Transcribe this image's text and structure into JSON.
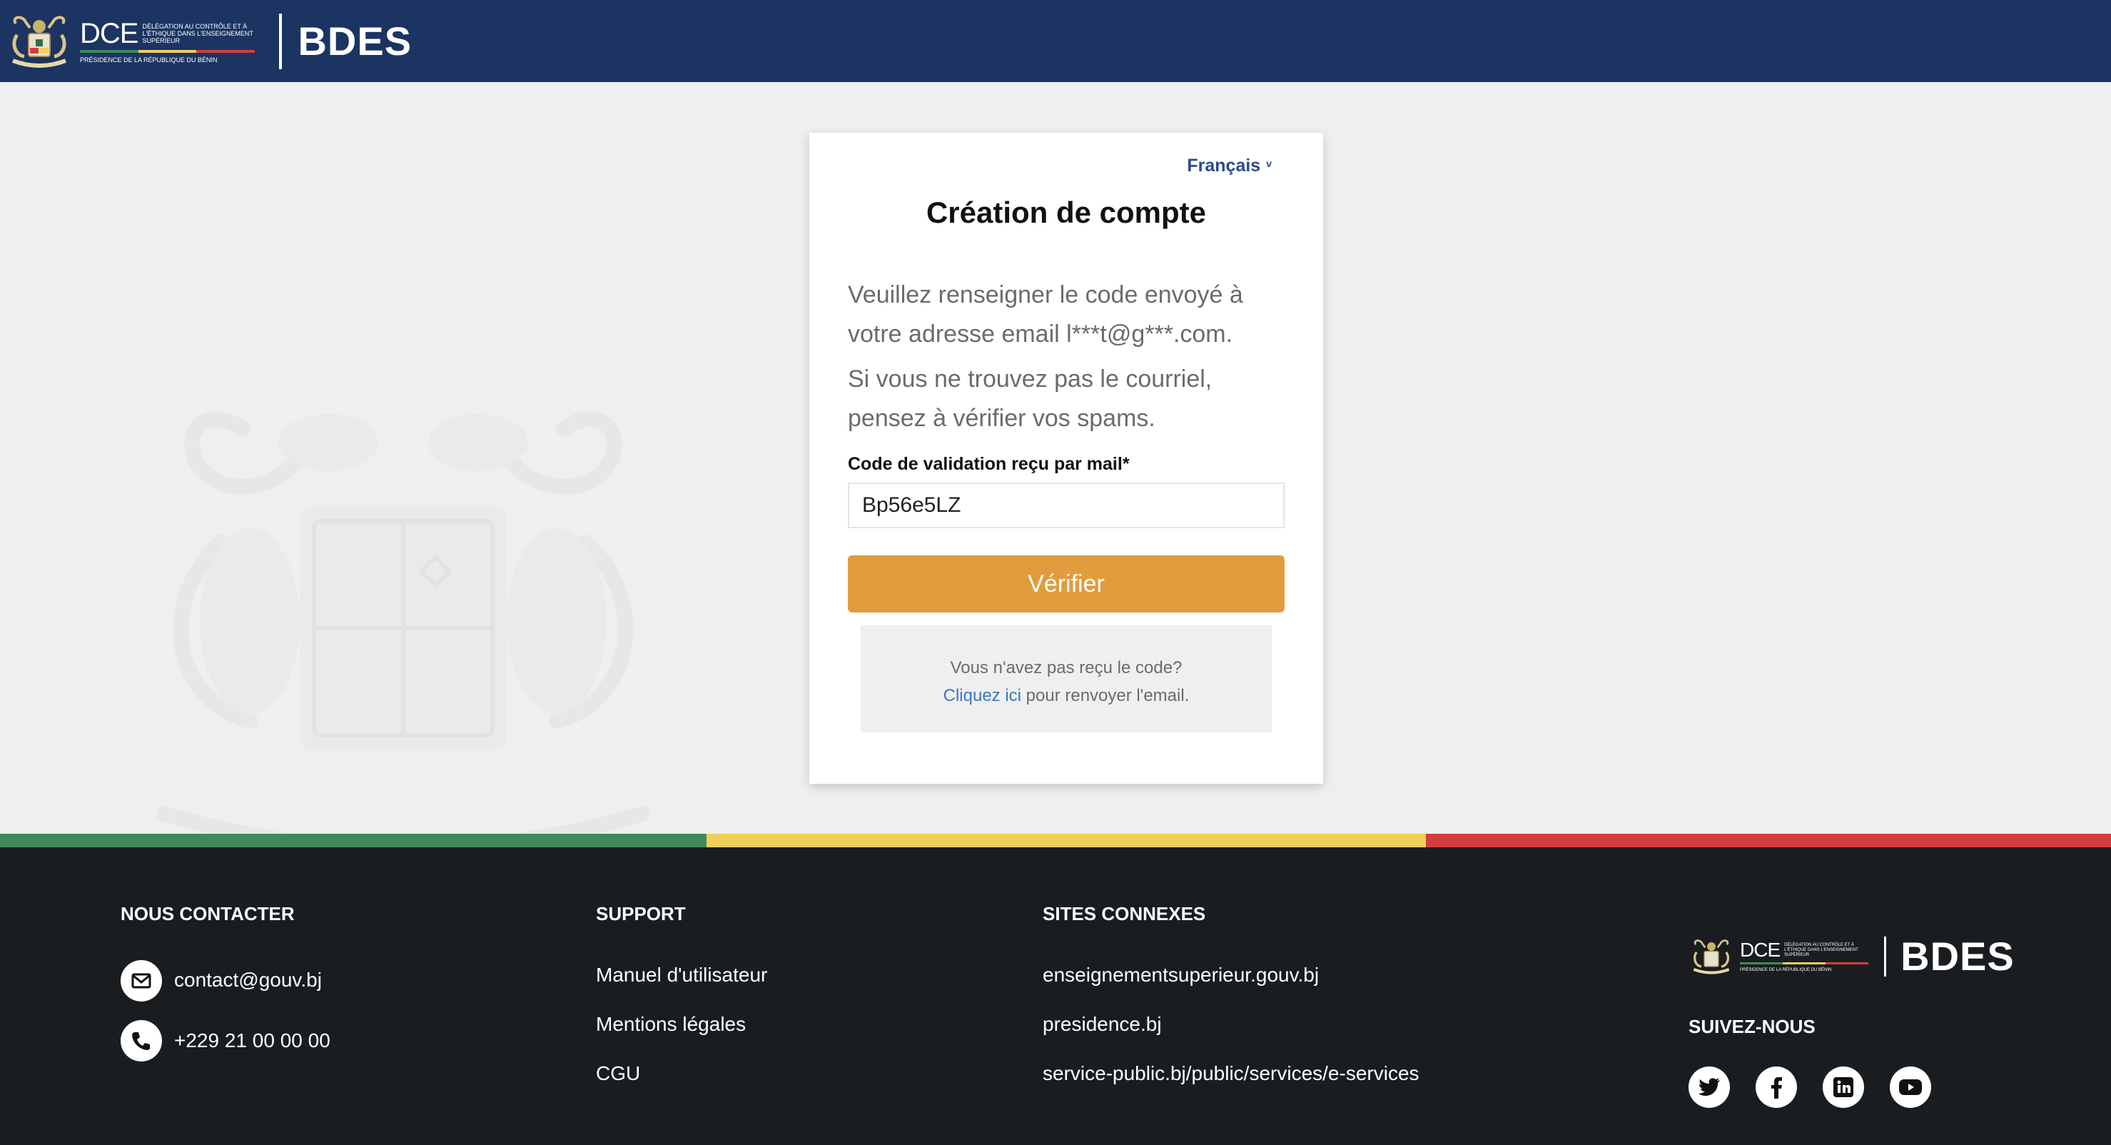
{
  "header": {
    "dce_letters": "DCE",
    "dce_subtitle": "Délégation au contrôle et à l'éthique dans l'enseignement supérieur",
    "presidency": "Présidence de la République du Bénin",
    "app_name": "BDES"
  },
  "card": {
    "language": "Français",
    "title": "Création de compte",
    "instruction_1": "Veuillez renseigner le code envoyé à votre adresse email l***t@g***.com.",
    "instruction_2": "Si vous ne trouvez pas le courriel, pensez à vérifier vos spams.",
    "code_label": "Code de validation reçu par mail*",
    "code_value": "Bp56e5LZ",
    "verify_label": "Vérifier",
    "resend_question": "Vous n'avez pas reçu le code?",
    "resend_link": "Cliquez ici",
    "resend_rest": " pour renvoyer l'email."
  },
  "footer": {
    "contact": {
      "heading": "NOUS CONTACTER",
      "email": "contact@gouv.bj",
      "phone": "+229 21 00 00 00"
    },
    "support": {
      "heading": "SUPPORT",
      "links": [
        "Manuel d'utilisateur",
        "Mentions légales",
        "CGU"
      ]
    },
    "sites": {
      "heading": "SITES CONNEXES",
      "links": [
        "enseignementsuperieur.gouv.bj",
        "presidence.bj",
        "service-public.bj/public/services/e-services"
      ]
    },
    "follow": {
      "heading": "SUIVEZ-NOUS",
      "icons": [
        "twitter-icon",
        "facebook-icon",
        "linkedin-icon",
        "youtube-icon"
      ]
    }
  },
  "colors": {
    "header_bg": "#1b3462",
    "accent_button": "#e19c3d",
    "link": "#3a76c4",
    "footer_bg": "#1a1d20",
    "flag_green": "#3f8a5b",
    "flag_yellow": "#f0d05a",
    "flag_red": "#d33e3c"
  }
}
